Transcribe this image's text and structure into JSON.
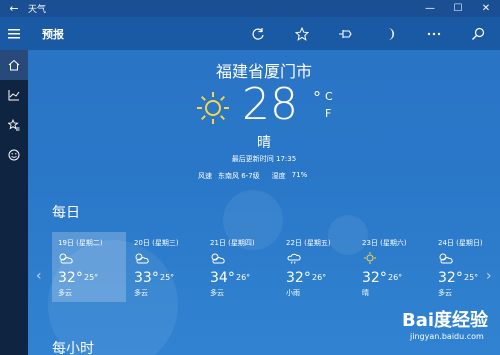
{
  "titlebar": {
    "title": "天气"
  },
  "toolbar": {
    "title": "预报"
  },
  "location": {
    "city": "福建省厦门市"
  },
  "current": {
    "temp": "28",
    "degree": "°",
    "unit_c": "C",
    "unit_f": "F",
    "condition": "晴",
    "updated": "最后更新时间 17:35",
    "wind_label": "风速",
    "wind_value": "东南风 6-7级",
    "humidity_label": "湿度",
    "humidity_value": "71%"
  },
  "daily": {
    "title": "每日",
    "days": [
      {
        "date": "19日 (星期二)",
        "high": "32°",
        "low": "25°",
        "condition": "多云",
        "icon": "partly-cloudy-icon"
      },
      {
        "date": "20日 (星期三)",
        "high": "33°",
        "low": "25°",
        "condition": "多云",
        "icon": "partly-cloudy-icon"
      },
      {
        "date": "21日 (星期四)",
        "high": "34°",
        "low": "26°",
        "condition": "多云",
        "icon": "partly-cloudy-icon"
      },
      {
        "date": "22日 (星期五)",
        "high": "32°",
        "low": "26°",
        "condition": "小雨",
        "icon": "light-rain-icon"
      },
      {
        "date": "23日 (星期六)",
        "high": "32°",
        "low": "26°",
        "condition": "晴",
        "icon": "sunny-icon"
      },
      {
        "date": "24日 (星期日)",
        "high": "32°",
        "low": "25°",
        "condition": "多云",
        "icon": "partly-cloudy-icon"
      }
    ]
  },
  "hourly": {
    "title": "每小时"
  },
  "watermark": {
    "brand": "Bai度经验",
    "url": "jingyan.baidu.com"
  }
}
